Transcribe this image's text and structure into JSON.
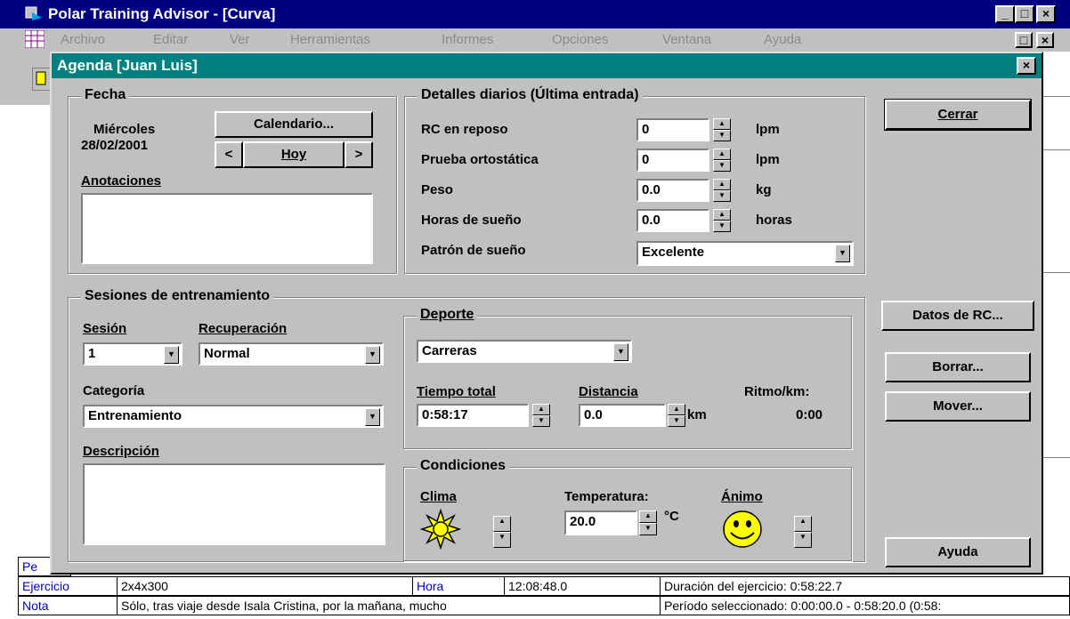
{
  "app": {
    "title": "Polar Training Advisor - [Curva]",
    "menu": [
      "Archivo",
      "Editar",
      "Ver",
      "Herramientas",
      "Informes",
      "Opciones",
      "Ventana",
      "Ayuda"
    ],
    "caption_buttons": {
      "minimize": "_",
      "restore": "□",
      "close": "×"
    }
  },
  "dialog": {
    "title": "Agenda [Juan Luis]",
    "close_glyph": "×"
  },
  "fecha": {
    "group_title": "Fecha",
    "day": "Miércoles",
    "date": "28/02/2001",
    "calendar_button": "Calendario...",
    "prev_button": "<",
    "today_button": "Hoy",
    "next_button": ">",
    "notes_label": "Anotaciones",
    "notes_value": ""
  },
  "detalles": {
    "group_title": "Detalles diarios (Última entrada)",
    "rows": [
      {
        "label": "RC en reposo",
        "value": "0",
        "unit": "lpm"
      },
      {
        "label": "Prueba ortostática",
        "value": "0",
        "unit": "lpm"
      },
      {
        "label": "Peso",
        "value": "0.0",
        "unit": "kg"
      },
      {
        "label": "Horas de sueño",
        "value": "0.0",
        "unit": "horas"
      }
    ],
    "sleep_pattern_label": "Patrón de sueño",
    "sleep_pattern_value": "Excelente"
  },
  "buttons": {
    "close": "Cerrar",
    "hr_data": "Datos de RC...",
    "delete": "Borrar...",
    "move": "Mover...",
    "help": "Ayuda"
  },
  "sesiones": {
    "group_title": "Sesiones de entrenamiento",
    "session_label": "Sesión",
    "session_value": "1",
    "recovery_label": "Recuperación",
    "recovery_value": "Normal",
    "category_label": "Categoría",
    "category_value": "Entrenamiento",
    "description_label": "Descripción",
    "description_value": ""
  },
  "deporte": {
    "group_title": "Deporte",
    "sport_value": "Carreras",
    "total_time_label": "Tiempo total",
    "total_time_value": "0:58:17",
    "distance_label": "Distancia",
    "distance_value": "0.0",
    "distance_unit": "km",
    "pace_label": "Ritmo/km:",
    "pace_value": "0:00"
  },
  "condiciones": {
    "group_title": "Condiciones",
    "weather_label": "Clima",
    "temperature_label": "Temperatura:",
    "temperature_value": "20.0",
    "temperature_unit": "°C",
    "mood_label": "Ánimo"
  },
  "background_table": {
    "rows": [
      {
        "label": "Pe",
        "c2": "",
        "c3": "",
        "c4": "",
        "c5": ""
      },
      {
        "label": "Ejercicio",
        "c2": "2x4x300",
        "c3": "Hora",
        "c4": "12:08:48.0",
        "c5": "Duración del ejercicio: 0:58:22.7"
      },
      {
        "label": "Nota",
        "c2": "Sólo, tras viaje desde Isala Cristina, por la mañana, mucho",
        "c3": "",
        "c4": "",
        "c5": "Período seleccionado: 0:00:00.0 - 0:58:20.0 (0:58:"
      }
    ]
  }
}
